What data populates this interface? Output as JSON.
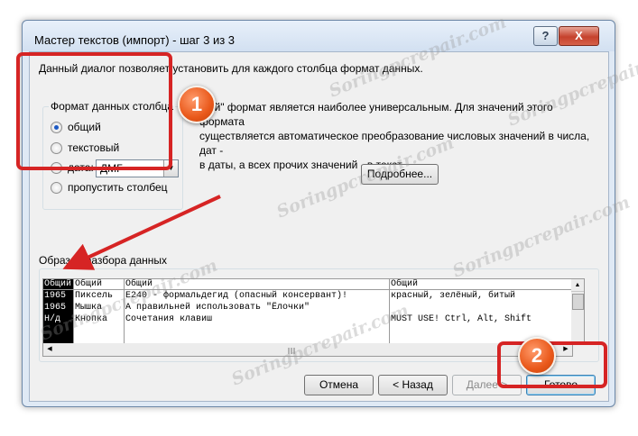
{
  "window": {
    "title": "Мастер текстов (импорт) - шаг 3 из 3",
    "help_label": "?",
    "close_label": "X"
  },
  "description": "Данный диалог позволяет установить для каждого столбца формат данных.",
  "column_format": {
    "group_title": "Формат данных столбца",
    "options": [
      "общий",
      "текстовый",
      "дата:",
      "пропустить столбец"
    ],
    "selected": "общий",
    "date_format": "ДМГ"
  },
  "info_lines": [
    "щий\" формат является наиболее универсальным. Для значений этого формата",
    "существляется автоматическое преобразование числовых значений в числа, дат -",
    "в даты, а всех прочих значений - в текст."
  ],
  "details_button": "Подробнее...",
  "preview": {
    "label": "Образец разбора данных",
    "headers": [
      "Общий",
      "Общий",
      "Общий",
      "Общий"
    ],
    "rows": [
      [
        "1965",
        "Пиксель",
        "E240 - формальдегид (опасный консервант)!",
        "красный, зелёный, битый"
      ],
      [
        "1965",
        "Мышка",
        "А правильней использовать \"Ёлочки\"",
        ""
      ],
      [
        "Н/д",
        "Кнопка",
        "Сочетания клавиш",
        "MUST USE! Ctrl, Alt, Shift"
      ]
    ]
  },
  "buttons": {
    "cancel": "Отмена",
    "back": "< Назад",
    "next": "Далее >",
    "finish": "Готово"
  },
  "annotations": {
    "badge1": "1",
    "badge2": "2",
    "highlight_color": "#d62424",
    "badge_color": "#e9581a"
  },
  "watermark": "Soringpcrepair.com"
}
